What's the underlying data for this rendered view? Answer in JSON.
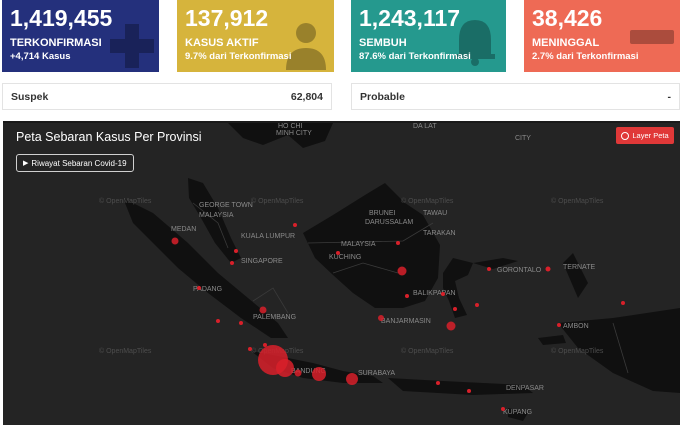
{
  "stats": {
    "confirmed": {
      "value": "1,419,455",
      "label": "TERKONFIRMASI",
      "sub": "+4,714 Kasus",
      "color": "#24307c",
      "icon": "plus-icon"
    },
    "active": {
      "value": "137,912",
      "label": "KASUS AKTIF",
      "sub": "9.7% dari Terkonfirmasi",
      "color": "#d6b43c",
      "icon": "patient-icon"
    },
    "recovered": {
      "value": "1,243,117",
      "label": "SEMBUH",
      "sub": "87.6% dari Terkonfirmasi",
      "color": "#25998e",
      "icon": "bell-icon"
    },
    "deaths": {
      "value": "38,426",
      "label": "MENINGGAL",
      "sub": "2.7% dari Terkonfirmasi",
      "color": "#ee6a55",
      "icon": "minus-icon"
    }
  },
  "suspek": {
    "label": "Suspek",
    "value": "62,804"
  },
  "probable": {
    "label": "Probable",
    "value": "-"
  },
  "map": {
    "title": "Peta Sebaran Kasus Per Provinsi",
    "history_button": "Riwayat Sebaran Covid-19",
    "layer_button": "Layer Peta",
    "attribution": "© OpenMapTiles",
    "places": [
      "HO CHI",
      "MINH CITY",
      "DA LAT",
      "CITY",
      "GEORGE TOWN",
      "MALAYSIA",
      "MEDAN",
      "KUALA LUMPUR",
      "SINGAPORE",
      "PADANG",
      "PALEMBANG",
      "BRUNEI",
      "DARUSSALAM",
      "TAWAU",
      "TARAKAN",
      "MALAYSIA",
      "KUCHING",
      "GORONTALO",
      "TERNATE",
      "BALIKPAPAN",
      "BANJARMASIN",
      "AMBON",
      "BANDUNG",
      "SURABAYA",
      "DENPASAR",
      "KUPANG"
    ]
  }
}
